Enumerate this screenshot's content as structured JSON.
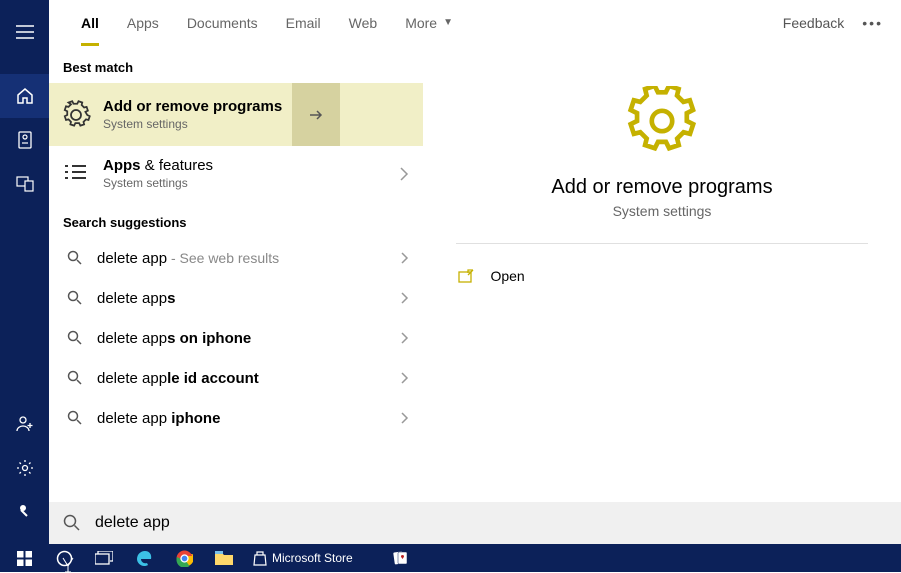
{
  "tabs": {
    "all": "All",
    "apps": "Apps",
    "documents": "Documents",
    "email": "Email",
    "web": "Web",
    "more": "More"
  },
  "feedback": "Feedback",
  "sections": {
    "best_match": "Best match",
    "search_suggestions": "Search suggestions"
  },
  "results": {
    "best": {
      "title": "Add or remove programs",
      "subtitle": "System settings"
    },
    "second": {
      "title_bold": "Apps",
      "title_rest": " & features",
      "subtitle": "System settings"
    }
  },
  "suggestions": [
    {
      "prefix": "delete app",
      "bold": "",
      "hint": " - See web results"
    },
    {
      "prefix": "delete app",
      "bold": "s",
      "hint": ""
    },
    {
      "prefix": "delete app",
      "bold": "s on iphone",
      "hint": ""
    },
    {
      "prefix": "delete app",
      "bold": "le id account",
      "hint": ""
    },
    {
      "prefix": "delete app",
      "bold": " iphone",
      "hint": ""
    }
  ],
  "detail": {
    "title": "Add or remove programs",
    "subtitle": "System settings",
    "open": "Open"
  },
  "search_query": "delete app",
  "taskbar": {
    "ms_store": "Microsoft Store"
  },
  "colors": {
    "accent": "#c5b100",
    "rail": "#0c2159"
  }
}
